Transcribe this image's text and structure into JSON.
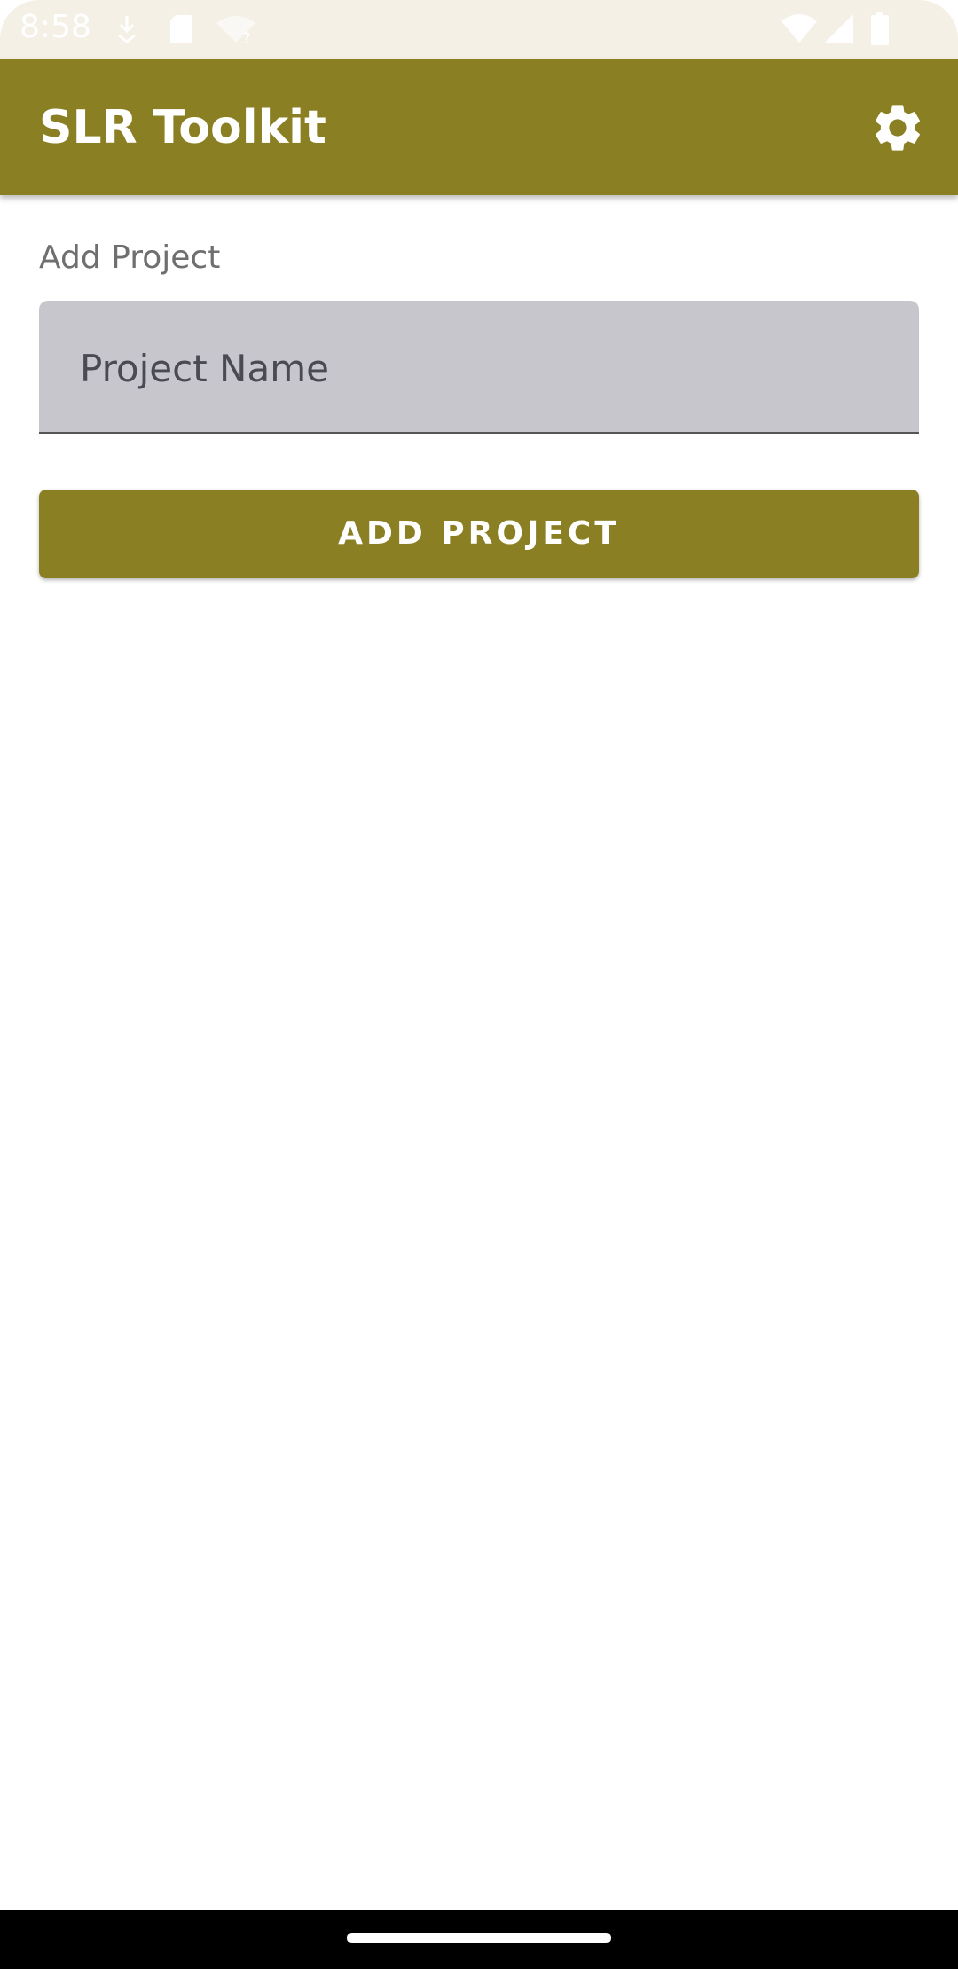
{
  "status_bar": {
    "time": "8:58",
    "icons": [
      "download-icon",
      "sd-card-icon",
      "wifi-unknown-icon",
      "wifi-icon",
      "signal-icon",
      "battery-icon"
    ]
  },
  "app_bar": {
    "title": "SLR Toolkit",
    "settings_icon": "gear-icon"
  },
  "form": {
    "section_label": "Add Project",
    "project_name_placeholder": "Project Name",
    "project_name_value": "",
    "add_button_label": "ADD PROJECT"
  },
  "colors": {
    "primary": "#8a8023",
    "status_bar_bg": "#f4f0e6",
    "input_bg": "#c6c6cc"
  }
}
